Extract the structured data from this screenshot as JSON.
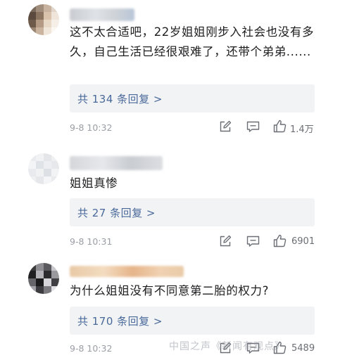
{
  "comments": [
    {
      "text": "这不太合适吧，22岁姐姐刚步入社会也没有多久，自己生活已经很艰难了，还带个弟弟......",
      "replies_label": "共 134 条回复 >",
      "time": "9-8 10:32",
      "likes": "1.4万"
    },
    {
      "text": "姐姐真惨",
      "replies_label": "共 27 条回复 >",
      "time": "9-8 10:31",
      "likes": "6901"
    },
    {
      "text": "为什么姐姐没有不同意第二胎的权力?",
      "replies_label": "共 170 条回复 >",
      "time": "9-8 10:32",
      "likes": "5489"
    }
  ],
  "watermark": "中国之声《新闻有观点》",
  "colors": {
    "reply_link": "#49699a",
    "reply_bg": "#f2f3f5",
    "meta_gray": "#9a9ea5"
  },
  "icons": [
    "edit-icon",
    "comment-icon",
    "thumbs-up-icon"
  ]
}
